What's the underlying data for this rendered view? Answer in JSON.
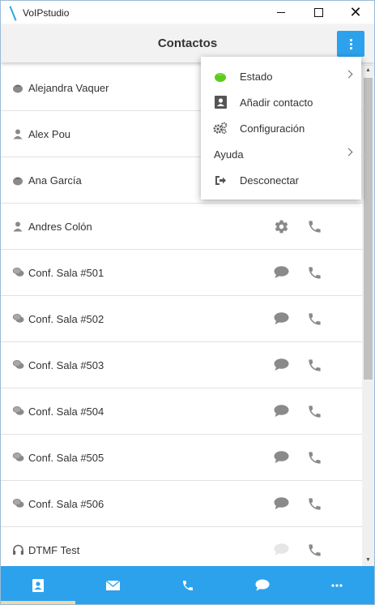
{
  "window": {
    "title": "VoIPstudio"
  },
  "header": {
    "title": "Contactos"
  },
  "contacts": [
    {
      "name": "Alejandra Vaquer",
      "icon": "status-dot-icon"
    },
    {
      "name": "Alex Pou",
      "icon": "person-icon"
    },
    {
      "name": "Ana García",
      "icon": "status-dot-icon"
    },
    {
      "name": "Andres Colón",
      "icon": "person-icon"
    },
    {
      "name": "Conf. Sala #501",
      "icon": "chat-icon"
    },
    {
      "name": "Conf. Sala #502",
      "icon": "chat-icon"
    },
    {
      "name": "Conf. Sala #503",
      "icon": "chat-icon"
    },
    {
      "name": "Conf. Sala #504",
      "icon": "chat-icon"
    },
    {
      "name": "Conf. Sala #505",
      "icon": "chat-icon"
    },
    {
      "name": "Conf. Sala #506",
      "icon": "chat-icon"
    },
    {
      "name": "DTMF Test",
      "icon": "headset-icon"
    }
  ],
  "menu": {
    "items": [
      {
        "label": "Estado",
        "icon": "status-green-icon",
        "submenu": true
      },
      {
        "label": "Añadir contacto",
        "icon": "add-contact-icon",
        "submenu": false
      },
      {
        "label": "Configuración",
        "icon": "gears-icon",
        "submenu": false
      },
      {
        "label": "Ayuda",
        "icon": "",
        "submenu": true
      },
      {
        "label": "Desconectar",
        "icon": "logout-icon",
        "submenu": false
      }
    ]
  },
  "bottom_nav": [
    {
      "icon": "contacts-icon",
      "active": true
    },
    {
      "icon": "mail-icon",
      "active": false
    },
    {
      "icon": "phone-icon",
      "active": false
    },
    {
      "icon": "chat-icon",
      "active": false
    },
    {
      "icon": "more-icon",
      "active": false
    }
  ],
  "colors": {
    "accent": "#2da2ec",
    "icon_gray": "#8a8a8a",
    "status_green": "#5ccb1f"
  }
}
